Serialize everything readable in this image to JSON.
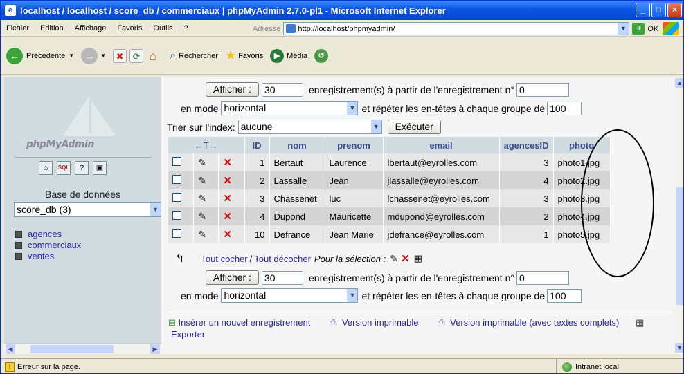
{
  "window": {
    "title": "localhost / localhost / score_db / commerciaux | phpMyAdmin 2.7.0-pl1 - Microsoft Internet Explorer"
  },
  "menu": [
    "Fichier",
    "Edition",
    "Affichage",
    "Favoris",
    "Outils",
    "?"
  ],
  "address": {
    "label": "Adresse",
    "url": "http://localhost/phpmyadmin/",
    "go_label": "OK"
  },
  "toolbar": {
    "back": "Précédente",
    "search": "Rechercher",
    "favorites": "Favoris",
    "media": "Média"
  },
  "sidebar": {
    "logo": "phpMyAdmin",
    "db_label": "Base de données",
    "db_selected": "score_db (3)",
    "tables": [
      "agences",
      "commerciaux",
      "ventes"
    ]
  },
  "nav_top": {
    "show_label": "Afficher :",
    "rows": "30",
    "from_text": "enregistrement(s) à partir de l'enregistrement n°",
    "from_value": "0",
    "mode_label": "en mode",
    "mode_value": "horizontal",
    "repeat_text": "et répéter les en-têtes à chaque groupe de",
    "repeat_value": "100"
  },
  "sort": {
    "label": "Trier sur l'index:",
    "value": "aucune",
    "exec": "Exécuter"
  },
  "table": {
    "headers": [
      "ID",
      "nom",
      "prenom",
      "email",
      "agencesID",
      "photo"
    ],
    "rows": [
      [
        "1",
        "Bertaut",
        "Laurence",
        "lbertaut@eyrolles.com",
        "3",
        "photo1.jpg"
      ],
      [
        "2",
        "Lassalle",
        "Jean",
        "jlassalle@eyrolles.com",
        "4",
        "photo2.jpg"
      ],
      [
        "3",
        "Chassenet",
        "luc",
        "lchassenet@eyrolles.com",
        "3",
        "photo3.jpg"
      ],
      [
        "4",
        "Dupond",
        "Mauricette",
        "mdupond@eyrolles.com",
        "2",
        "photo4.jpg"
      ],
      [
        "10",
        "Defrance",
        "Jean Marie",
        "jdefrance@eyrolles.com",
        "1",
        "photo5.jpg"
      ]
    ]
  },
  "selection": {
    "check_all": "Tout cocher",
    "uncheck_all": "Tout décocher",
    "for_selection": "Pour la sélection :"
  },
  "nav_bottom": {
    "show_label": "Afficher :",
    "rows": "30",
    "from_text": "enregistrement(s) à partir de l'enregistrement n°",
    "from_value": "0",
    "mode_label": "en mode",
    "mode_value": "horizontal",
    "repeat_text": "et répéter les en-têtes à chaque groupe de",
    "repeat_value": "100"
  },
  "actions": {
    "insert": "Insérer un nouvel enregistrement",
    "print": "Version imprimable",
    "print_full": "Version imprimable (avec textes complets)",
    "export": "Exporter"
  },
  "status": {
    "left": "Erreur sur la page.",
    "zone": "Intranet local"
  }
}
